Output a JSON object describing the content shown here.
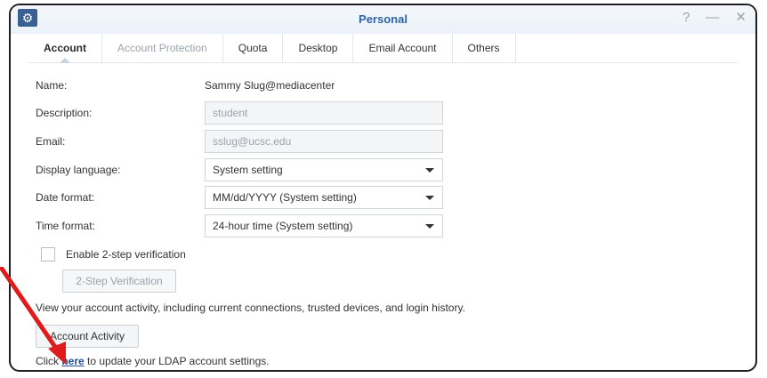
{
  "window": {
    "title": "Personal",
    "controls": {
      "help": "?",
      "minimize": "—",
      "close": "✕"
    }
  },
  "tabs": [
    {
      "label": "Account"
    },
    {
      "label": "Account Protection"
    },
    {
      "label": "Quota"
    },
    {
      "label": "Desktop"
    },
    {
      "label": "Email Account"
    },
    {
      "label": "Others"
    }
  ],
  "form": {
    "name_label": "Name:",
    "name_value": "Sammy Slug@mediacenter",
    "description_label": "Description:",
    "description_value": "student",
    "email_label": "Email:",
    "email_value": "sslug@ucsc.edu",
    "language_label": "Display language:",
    "language_value": "System setting",
    "date_label": "Date format:",
    "date_value": "MM/dd/YYYY (System setting)",
    "time_label": "Time format:",
    "time_value": "24-hour time (System setting)"
  },
  "twostep": {
    "checkbox_label": "Enable 2-step verification",
    "button_label": "2-Step Verification"
  },
  "activity": {
    "description": "View your account activity, including current connections, trusted devices, and login history.",
    "button_label": "Account Activity"
  },
  "ldap": {
    "prefix": "Click ",
    "link_text": "here",
    "suffix": " to update your LDAP account settings."
  },
  "colors": {
    "accent": "#2f64a6",
    "link": "#1f4f97",
    "annotation_arrow": "#e01b1b"
  }
}
